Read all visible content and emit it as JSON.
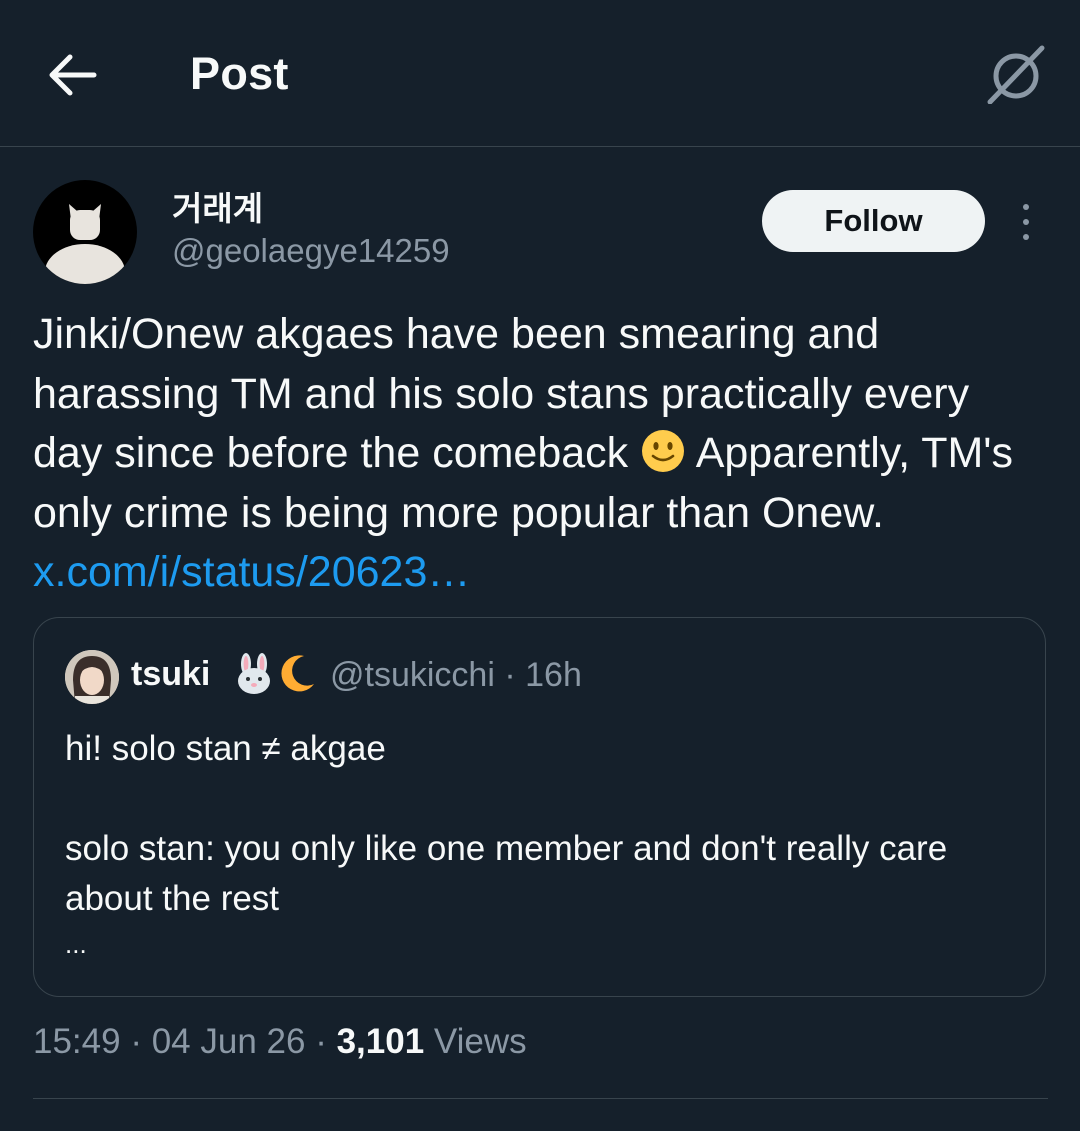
{
  "header": {
    "title": "Post",
    "back_icon": "arrow-left-icon",
    "grok_icon": "grok-icon"
  },
  "author": {
    "display_name": "거래계",
    "handle": "@geolaegye14259",
    "follow_label": "Follow"
  },
  "tweet": {
    "text_before_emoji": "Jinki/Onew akgaes have been smearing and harassing TM and his solo stans practically every day since before the comeback ",
    "emoji": "slightly-smiling-face-emoji",
    "text_after_emoji": " Apparently, TM's only crime is being more popular than Onew. ",
    "link": "x.com/i/status/20623…"
  },
  "quote": {
    "name": "tsuki",
    "name_emojis": [
      "rabbit-face-emoji",
      "crescent-moon-emoji"
    ],
    "handle": "@tsukicchi",
    "separator": "·",
    "time": "16h",
    "lines": [
      "hi! solo stan ≠ akgae",
      "",
      "solo stan: you only like one member and don't really care about the rest",
      "..."
    ]
  },
  "meta": {
    "time": "15:49",
    "date": "04 Jun 26",
    "sep": "·",
    "views_count": "3,101",
    "views_label": "Views"
  },
  "colors": {
    "background": "#15202b",
    "text": "#f7f9f9",
    "secondary": "#8b98a5",
    "link": "#1d9bf0",
    "border": "#38444d"
  }
}
